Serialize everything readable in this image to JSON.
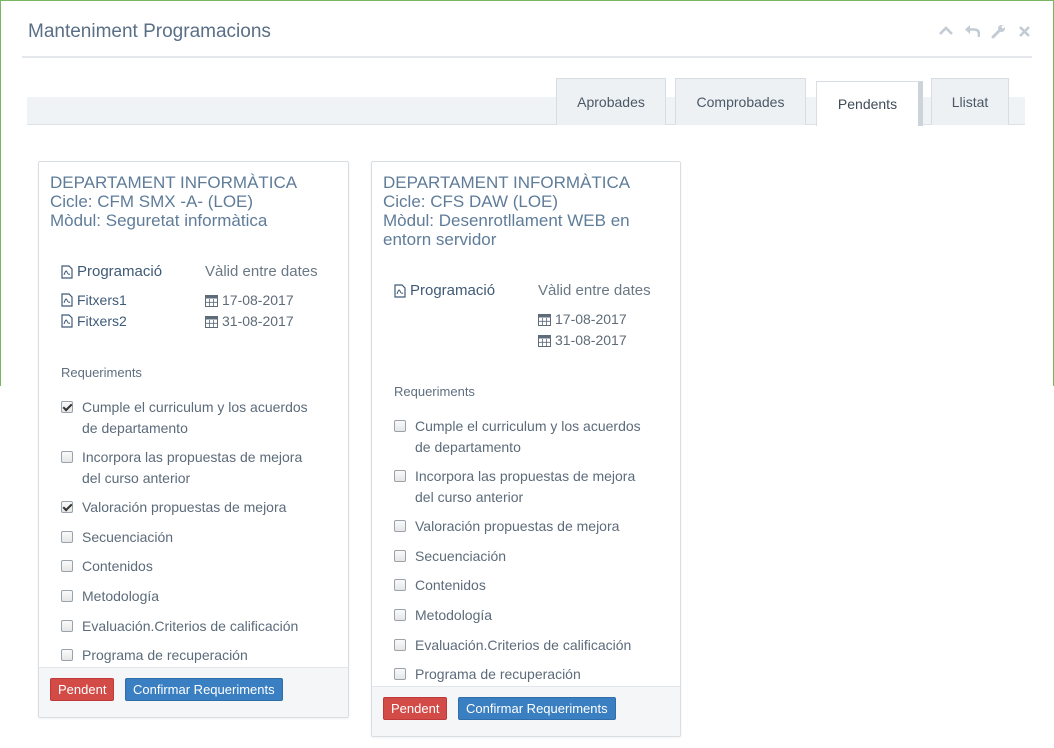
{
  "header": {
    "title": "Manteniment Programacions"
  },
  "toolbar": {
    "icons": [
      "chevron-up-icon",
      "undo-icon",
      "wrench-icon",
      "close-icon"
    ]
  },
  "tabs": [
    {
      "label": "Aprobades"
    },
    {
      "label": "Comprobades"
    },
    {
      "label": "Pendents",
      "active": true
    },
    {
      "label": "Llistat"
    }
  ],
  "colors": {
    "accent_blue": "#3a7fc1",
    "danger_red": "#d24b47",
    "frame_green": "#7bb661"
  },
  "cards": [
    {
      "title_lines": [
        "DEPARTAMENT INFORMÀTICA",
        "Cicle: CFM SMX -A- (LOE)",
        "Mòdul: Seguretat informàtica"
      ],
      "col_programacio": "Programació",
      "col_dates": "Vàlid entre dates",
      "files": [
        "Fitxers1",
        "Fitxers2"
      ],
      "dates": [
        "17-08-2017",
        "31-08-2017"
      ],
      "requeriments_title": "Requeriments",
      "requirements": [
        {
          "lines": [
            "Cumple el curriculum y los acuerdos",
            "de departamento"
          ],
          "checked": true
        },
        {
          "lines": [
            "Incorpora las propuestas de mejora",
            "del curso anterior"
          ],
          "checked": false
        },
        {
          "lines": [
            "Valoración propuestas de mejora"
          ],
          "checked": true
        },
        {
          "lines": [
            "Secuenciación"
          ],
          "checked": false
        },
        {
          "lines": [
            "Contenidos"
          ],
          "checked": false
        },
        {
          "lines": [
            "Metodología"
          ],
          "checked": false
        },
        {
          "lines": [
            "Evaluación.Criterios de calificación"
          ],
          "checked": false
        },
        {
          "lines": [
            "Programa de recuperación"
          ],
          "checked": false
        }
      ],
      "btn_pendent": "Pendent",
      "btn_confirm": "Confirmar Requeriments"
    },
    {
      "title_lines": [
        "DEPARTAMENT INFORMÀTICA",
        "Cicle: CFS DAW (LOE)",
        "Mòdul: Desenrotllament WEB en",
        "entorn servidor"
      ],
      "col_programacio": "Programació",
      "col_dates": "Vàlid entre dates",
      "files": [],
      "dates": [
        "17-08-2017",
        "31-08-2017"
      ],
      "requeriments_title": "Requeriments",
      "requirements": [
        {
          "lines": [
            "Cumple el curriculum y los acuerdos",
            "de departamento"
          ],
          "checked": false
        },
        {
          "lines": [
            "Incorpora las propuestas de mejora",
            "del curso anterior"
          ],
          "checked": false
        },
        {
          "lines": [
            "Valoración propuestas de mejora"
          ],
          "checked": false
        },
        {
          "lines": [
            "Secuenciación"
          ],
          "checked": false
        },
        {
          "lines": [
            "Contenidos"
          ],
          "checked": false
        },
        {
          "lines": [
            "Metodología"
          ],
          "checked": false
        },
        {
          "lines": [
            "Evaluación.Criterios de calificación"
          ],
          "checked": false
        },
        {
          "lines": [
            "Programa de recuperación"
          ],
          "checked": false
        }
      ],
      "btn_pendent": "Pendent",
      "btn_confirm": "Confirmar Requeriments"
    }
  ]
}
